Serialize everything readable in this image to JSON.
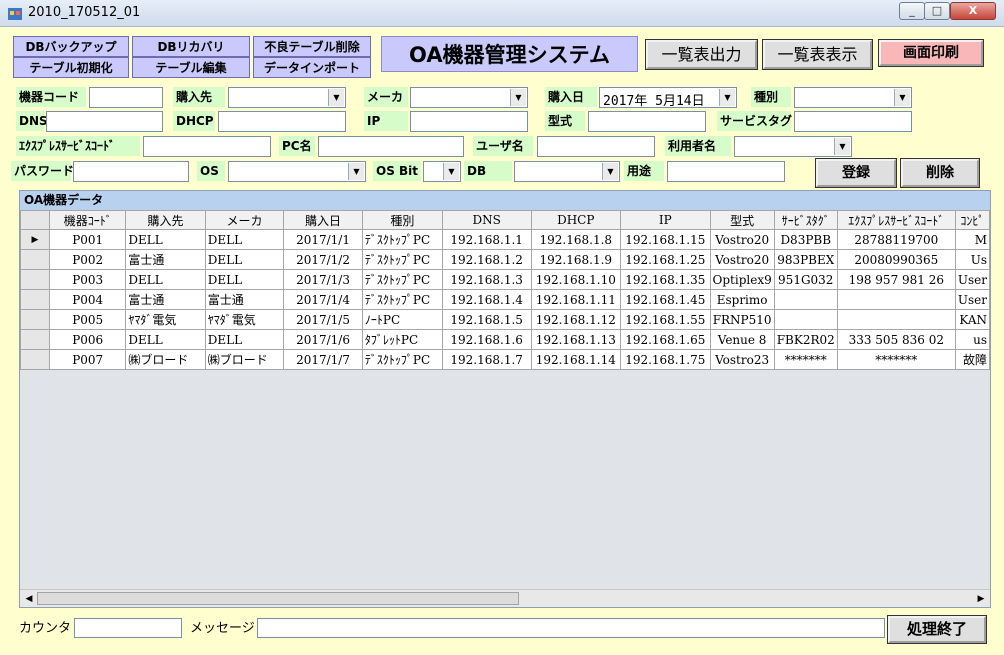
{
  "window": {
    "title": "2010_170512_01",
    "min": "_",
    "max": "□",
    "close": "X"
  },
  "toolbar": {
    "db_backup": "DBバックアップ",
    "db_recovery": "DBリカバリ",
    "bad_table_delete": "不良テーブル削除",
    "table_init": "テーブル初期化",
    "table_edit": "テーブル編集",
    "data_import": "データインポート",
    "app_title": "OA機器管理システム",
    "list_output": "一覧表出力",
    "list_display": "一覧表表示",
    "screen_print": "画面印刷"
  },
  "form": {
    "device_code": "機器コード",
    "purchase_from": "購入先",
    "maker": "メーカ",
    "purchase_date": "購入日",
    "purchase_date_value": "2017年 5月14日",
    "type": "種別",
    "dns": "DNS",
    "dhcp": "DHCP",
    "ip": "IP",
    "model": "型式",
    "service_tag": "サービスタグ",
    "express_code": "ｴｸｽﾌﾟﾚｽｻｰﾋﾞｽｺｰﾄﾞ",
    "pc_name": "PC名",
    "user_name": "ユーザ名",
    "user_person": "利用者名",
    "password": "パスワード",
    "os": "OS",
    "os_bit": "OS Bit",
    "db": "DB",
    "purpose": "用途",
    "register": "登録",
    "delete": "削除"
  },
  "grid": {
    "caption": "OA機器データ",
    "columns": [
      "機器ｺｰﾄﾞ",
      "購入先",
      "メーカ",
      "購入日",
      "種別",
      "DNS",
      "DHCP",
      "IP",
      "型式",
      "ｻｰﾋﾞｽﾀｸﾞ",
      "ｴｸｽﾌﾟﾚｽｻｰﾋﾞｽｺｰﾄﾞ",
      "ｺﾝﾋﾟ"
    ],
    "current_row_marker": "▶",
    "rows": [
      [
        "P001",
        "DELL",
        "DELL",
        "2017/1/1",
        "ﾃﾞｽｸﾄｯﾌﾟPC",
        "192.168.1.1",
        "192.168.1.8",
        "192.168.1.15",
        "Vostro20",
        "D83PBB",
        "28788119700",
        "M"
      ],
      [
        "P002",
        "富士通",
        "DELL",
        "2017/1/2",
        "ﾃﾞｽｸﾄｯﾌﾟPC",
        "192.168.1.2",
        "192.168.1.9",
        "192.168.1.25",
        "Vostro20",
        "983PBEX",
        "20080990365",
        "Us"
      ],
      [
        "P003",
        "DELL",
        "DELL",
        "2017/1/3",
        "ﾃﾞｽｸﾄｯﾌﾟPC",
        "192.168.1.3",
        "192.168.1.10",
        "192.168.1.35",
        "Optiplex9",
        "951G032",
        "198 957 981 26",
        "User"
      ],
      [
        "P004",
        "富士通",
        "富士通",
        "2017/1/4",
        "ﾃﾞｽｸﾄｯﾌﾟPC",
        "192.168.1.4",
        "192.168.1.11",
        "192.168.1.45",
        "Esprimo",
        "",
        "",
        "User"
      ],
      [
        "P005",
        "ﾔﾏﾀﾞ電気",
        "ﾔﾏﾀﾞ電気",
        "2017/1/5",
        "ﾉｰﾄPC",
        "192.168.1.5",
        "192.168.1.12",
        "192.168.1.55",
        "FRNP510",
        "",
        "",
        "KAN"
      ],
      [
        "P006",
        "DELL",
        "DELL",
        "2017/1/6",
        "ﾀﾌﾞﾚｯﾄPC",
        "192.168.1.6",
        "192.168.1.13",
        "192.168.1.65",
        "Venue 8",
        "FBK2R02",
        "333 505 836 02",
        "us"
      ],
      [
        "P007",
        "㈱ブロード",
        "㈱ブロード",
        "2017/1/7",
        "ﾃﾞｽｸﾄｯﾌﾟPC",
        "192.168.1.7",
        "192.168.1.14",
        "192.168.1.75",
        "Vostro23",
        "*******",
        "*******",
        "故障"
      ]
    ]
  },
  "status": {
    "counter_label": "カウンタ",
    "message_label": "メッセージ",
    "finish": "処理終了"
  }
}
